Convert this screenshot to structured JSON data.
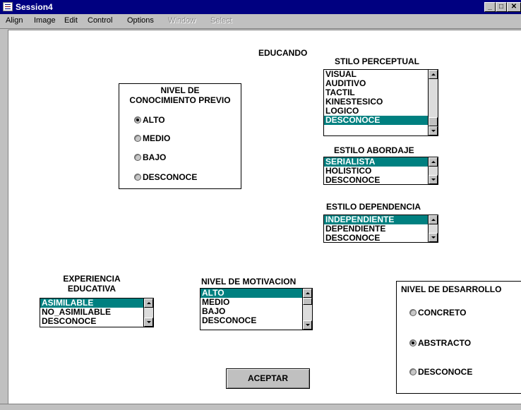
{
  "window": {
    "title": "Session4"
  },
  "menu": [
    "Align",
    "Image",
    "Edit",
    "Control",
    "Options",
    "Window",
    "Select"
  ],
  "form": {
    "heading": "EDUCANDO",
    "conocimiento": {
      "title": "NIVEL DE\nCONOCIMIENTO PREVIO",
      "options": [
        "ALTO",
        "MEDIO",
        "BAJO",
        "DESCONOCE"
      ],
      "selected": "ALTO"
    },
    "estilo_perceptual": {
      "title": "STILO PERCEPTUAL",
      "items": [
        "VISUAL",
        "AUDITIVO",
        "TACTIL",
        "KINESTESICO",
        "LOGICO",
        "DESCONOCE"
      ],
      "selected": "DESCONOCE"
    },
    "estilo_abordaje": {
      "title": "ESTILO ABORDAJE",
      "items": [
        "SERIALISTA",
        "HOLISTICO",
        "DESCONOCE"
      ],
      "selected": "SERIALISTA"
    },
    "estilo_dependencia": {
      "title": "ESTILO DEPENDENCIA",
      "items": [
        "INDEPENDIENTE",
        "DEPENDIENTE",
        "DESCONOCE"
      ],
      "selected": "INDEPENDIENTE"
    },
    "experiencia": {
      "title": "EXPERIENCIA\nEDUCATIVA",
      "items": [
        "ASIMILABLE",
        "NO_ASIMILABLE",
        "DESCONOCE"
      ],
      "selected": "ASIMILABLE"
    },
    "motivacion": {
      "title": "NIVEL DE MOTIVACION",
      "items": [
        "ALTO",
        "MEDIO",
        "BAJO",
        "DESCONOCE"
      ],
      "selected": "ALTO"
    },
    "desarrollo": {
      "title": "NIVEL DE DESARROLLO",
      "options": [
        "CONCRETO",
        "ABSTRACTO",
        "DESCONOCE"
      ],
      "selected": "ABSTRACTO"
    },
    "accept_label": "ACEPTAR"
  }
}
